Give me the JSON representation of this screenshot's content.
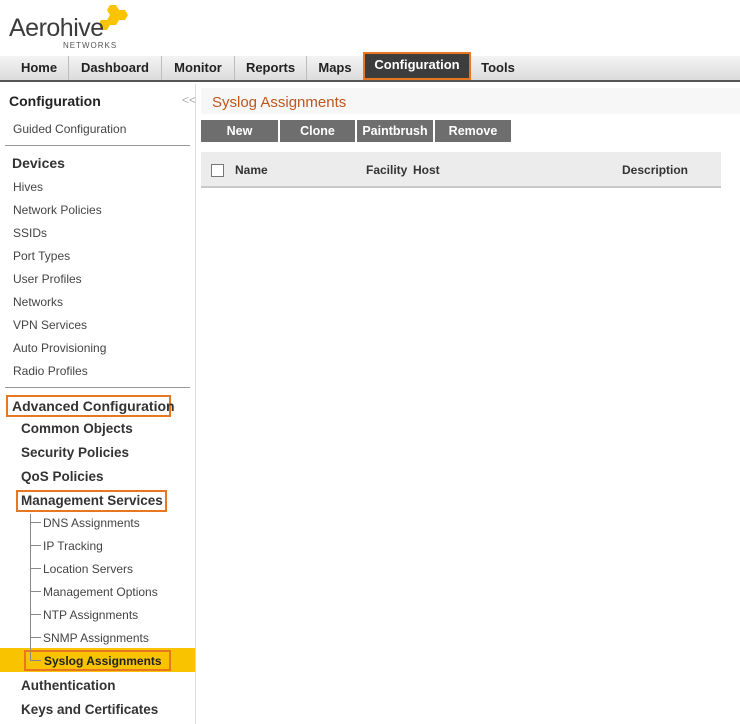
{
  "logo": {
    "name": "Aerohive",
    "sub": "NETWORKS"
  },
  "nav": {
    "items": [
      "Home",
      "Dashboard",
      "Monitor",
      "Reports",
      "Maps",
      "Configuration",
      "Tools"
    ],
    "active": "Configuration"
  },
  "sidebar": {
    "title": "Configuration",
    "collapse_glyph": "<<",
    "guided": "Guided Configuration",
    "devices_heading": "Devices",
    "devices": [
      "Hives",
      "Network Policies",
      "SSIDs",
      "Port Types",
      "User Profiles",
      "Networks",
      "VPN Services",
      "Auto Provisioning",
      "Radio Profiles"
    ],
    "advanced_heading": "Advanced Configuration",
    "advanced": [
      "Common Objects",
      "Security Policies",
      "QoS Policies",
      "Management Services"
    ],
    "management_services": [
      "DNS Assignments",
      "IP Tracking",
      "Location Servers",
      "Management Options",
      "NTP Assignments",
      "SNMP Assignments",
      "Syslog Assignments"
    ],
    "after": [
      "Authentication",
      "Keys and Certificates"
    ],
    "selected": "Syslog Assignments"
  },
  "main": {
    "title": "Syslog Assignments",
    "buttons": [
      "New",
      "Clone",
      "Paintbrush",
      "Remove"
    ],
    "columns": [
      "Name",
      "Facility",
      "Host",
      "Description"
    ]
  },
  "colors": {
    "accent": "#e87722",
    "selected": "#f9c300",
    "title": "#c0561a",
    "button": "#6e6e6e"
  }
}
